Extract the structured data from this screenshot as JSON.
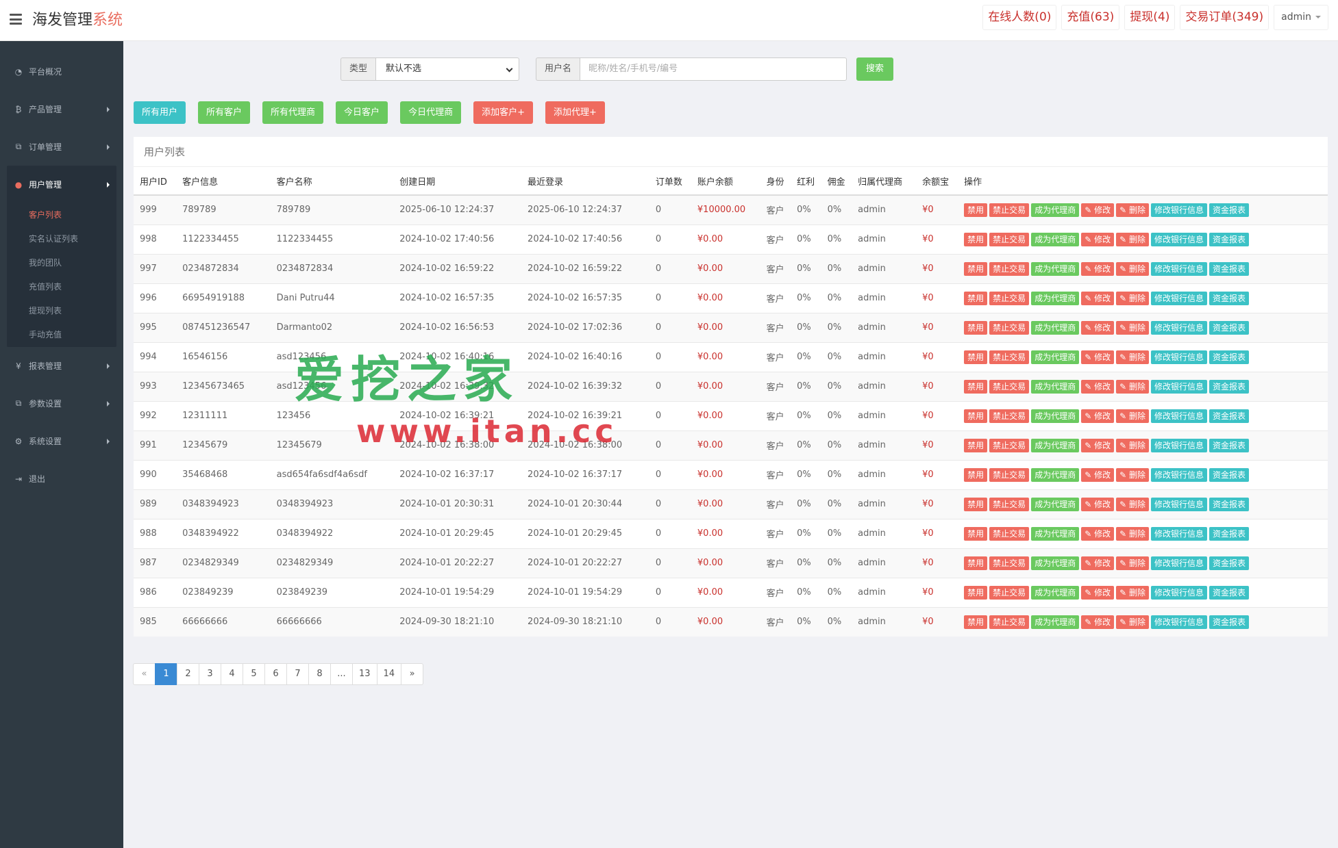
{
  "header": {
    "brand_main": "海发管理",
    "brand_accent": "系统",
    "buttons": [
      "在线人数(0)",
      "充值(63)",
      "提现(4)",
      "交易订单(349)"
    ],
    "admin_label": "admin"
  },
  "sidebar": {
    "items": [
      {
        "label": "平台概况",
        "icon": "dashboard-icon",
        "glyph": "◔"
      },
      {
        "label": "产品管理",
        "icon": "bitcoin-icon",
        "glyph": "₿"
      },
      {
        "label": "订单管理",
        "icon": "copy-icon",
        "glyph": "⧉"
      }
    ],
    "active_group": {
      "label": "用户管理",
      "icon": "user-icon",
      "glyph": "●"
    },
    "sub_items": [
      "客户列表",
      "实名认证列表",
      "我的团队",
      "充值列表",
      "提现列表",
      "手动充值"
    ],
    "items_after": [
      {
        "label": "报表管理",
        "icon": "yen-icon",
        "glyph": "¥"
      },
      {
        "label": "参数设置",
        "icon": "copy-icon",
        "glyph": "⧉"
      },
      {
        "label": "系统设置",
        "icon": "cogs-icon",
        "glyph": "⚙"
      },
      {
        "label": "退出",
        "icon": "logout-icon",
        "glyph": "⇥"
      }
    ]
  },
  "search": {
    "type_label": "类型",
    "type_value": "默认不选",
    "user_label": "用户名",
    "user_placeholder": "昵称/姓名/手机号/编号",
    "search_button": "搜索"
  },
  "filters": [
    {
      "label": "所有用户",
      "color": "teal"
    },
    {
      "label": "所有客户",
      "color": "green"
    },
    {
      "label": "所有代理商",
      "color": "green"
    },
    {
      "label": "今日客户",
      "color": "green"
    },
    {
      "label": "今日代理商",
      "color": "green"
    },
    {
      "label": "添加客户+",
      "color": "red"
    },
    {
      "label": "添加代理+",
      "color": "red"
    }
  ],
  "table": {
    "title": "用户列表",
    "columns": [
      "用户ID",
      "客户信息",
      "客户名称",
      "创建日期",
      "最近登录",
      "订单数",
      "账户余额",
      "身份",
      "红利",
      "佣金",
      "归属代理商",
      "余额宝",
      "操作"
    ],
    "actions": [
      {
        "label": "禁用",
        "color": "r"
      },
      {
        "label": "禁止交易",
        "color": "r"
      },
      {
        "label": "成为代理商",
        "color": "g"
      },
      {
        "label": "✎ 修改",
        "color": "r"
      },
      {
        "label": "✎ 删除",
        "color": "r"
      },
      {
        "label": "修改银行信息",
        "color": "c"
      },
      {
        "label": "资金报表",
        "color": "c"
      }
    ],
    "rows": [
      [
        "999",
        "789789",
        "789789",
        "2025-06-10 12:24:37",
        "2025-06-10 12:24:37",
        "0",
        "¥10000.00",
        "客户",
        "0%",
        "0%",
        "admin",
        "¥0"
      ],
      [
        "998",
        "1122334455",
        "1122334455",
        "2024-10-02 17:40:56",
        "2024-10-02 17:40:56",
        "0",
        "¥0.00",
        "客户",
        "0%",
        "0%",
        "admin",
        "¥0"
      ],
      [
        "997",
        "0234872834",
        "0234872834",
        "2024-10-02 16:59:22",
        "2024-10-02 16:59:22",
        "0",
        "¥0.00",
        "客户",
        "0%",
        "0%",
        "admin",
        "¥0"
      ],
      [
        "996",
        "66954919188",
        "Dani Putru44",
        "2024-10-02 16:57:35",
        "2024-10-02 16:57:35",
        "0",
        "¥0.00",
        "客户",
        "0%",
        "0%",
        "admin",
        "¥0"
      ],
      [
        "995",
        "087451236547",
        "Darmanto02",
        "2024-10-02 16:56:53",
        "2024-10-02 17:02:36",
        "0",
        "¥0.00",
        "客户",
        "0%",
        "0%",
        "admin",
        "¥0"
      ],
      [
        "994",
        "16546156",
        "asd123456",
        "2024-10-02 16:40:16",
        "2024-10-02 16:40:16",
        "0",
        "¥0.00",
        "客户",
        "0%",
        "0%",
        "admin",
        "¥0"
      ],
      [
        "993",
        "12345673465",
        "asd123456",
        "2024-10-02 16:39:32",
        "2024-10-02 16:39:32",
        "0",
        "¥0.00",
        "客户",
        "0%",
        "0%",
        "admin",
        "¥0"
      ],
      [
        "992",
        "12311111",
        "123456",
        "2024-10-02 16:39:21",
        "2024-10-02 16:39:21",
        "0",
        "¥0.00",
        "客户",
        "0%",
        "0%",
        "admin",
        "¥0"
      ],
      [
        "991",
        "12345679",
        "12345679",
        "2024-10-02 16:38:00",
        "2024-10-02 16:38:00",
        "0",
        "¥0.00",
        "客户",
        "0%",
        "0%",
        "admin",
        "¥0"
      ],
      [
        "990",
        "35468468",
        "asd654fa6sdf4a6sdf",
        "2024-10-02 16:37:17",
        "2024-10-02 16:37:17",
        "0",
        "¥0.00",
        "客户",
        "0%",
        "0%",
        "admin",
        "¥0"
      ],
      [
        "989",
        "0348394923",
        "0348394923",
        "2024-10-01 20:30:31",
        "2024-10-01 20:30:44",
        "0",
        "¥0.00",
        "客户",
        "0%",
        "0%",
        "admin",
        "¥0"
      ],
      [
        "988",
        "0348394922",
        "0348394922",
        "2024-10-01 20:29:45",
        "2024-10-01 20:29:45",
        "0",
        "¥0.00",
        "客户",
        "0%",
        "0%",
        "admin",
        "¥0"
      ],
      [
        "987",
        "0234829349",
        "0234829349",
        "2024-10-01 20:22:27",
        "2024-10-01 20:22:27",
        "0",
        "¥0.00",
        "客户",
        "0%",
        "0%",
        "admin",
        "¥0"
      ],
      [
        "986",
        "023849239",
        "023849239",
        "2024-10-01 19:54:29",
        "2024-10-01 19:54:29",
        "0",
        "¥0.00",
        "客户",
        "0%",
        "0%",
        "admin",
        "¥0"
      ],
      [
        "985",
        "66666666",
        "66666666",
        "2024-09-30 18:21:10",
        "2024-09-30 18:21:10",
        "0",
        "¥0.00",
        "客户",
        "0%",
        "0%",
        "admin",
        "¥0"
      ]
    ]
  },
  "pagination": {
    "prev": "«",
    "pages": [
      "1",
      "2",
      "3",
      "4",
      "5",
      "6",
      "7",
      "8",
      "...",
      "13",
      "14"
    ],
    "active": "1",
    "next": "»"
  },
  "watermark": {
    "top": "爱挖之家",
    "bottom": "www.itan.cc"
  },
  "colors": {
    "accent_red": "#e96d5f",
    "money_red": "#c9302c",
    "green": "#6ac95f",
    "teal": "#3cc2c6",
    "sidebar_bg": "#2f3a43",
    "pager_active": "#3a8ad4"
  }
}
